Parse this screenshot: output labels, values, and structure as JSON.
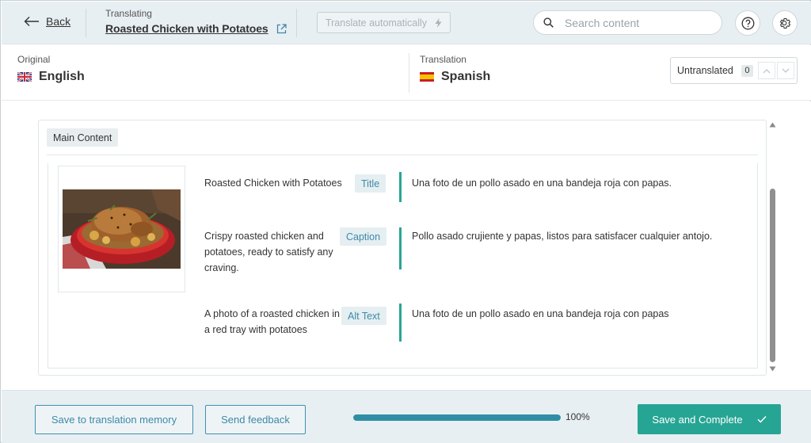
{
  "header": {
    "back_label": "Back",
    "translating_label": "Translating",
    "document_title": "Roasted Chicken with Potatoes",
    "translate_auto_label": "Translate automatically",
    "search_placeholder": "Search content"
  },
  "languages": {
    "original_label": "Original",
    "original_language": "English",
    "translation_label": "Translation",
    "translation_language": "Spanish",
    "filter_label": "Untranslated",
    "filter_count": "0"
  },
  "section": {
    "label": "Main Content",
    "rows": [
      {
        "source": "Roasted Chicken with Potatoes",
        "field": "Title",
        "target": "Una foto de un pollo asado en una bandeja roja con papas."
      },
      {
        "source": "Crispy roasted chicken and potatoes, ready to satisfy any craving.",
        "field": "Caption",
        "target": "Pollo asado crujiente y papas, listos para satisfacer cualquier antojo."
      },
      {
        "source": "A photo of a roasted chicken in a red tray with potatoes",
        "field": "Alt Text",
        "target": "Una foto de un pollo asado en una bandeja roja con papas"
      }
    ]
  },
  "footer": {
    "memory_label": "Save to translation memory",
    "feedback_label": "Send feedback",
    "progress_percent": 100,
    "progress_label": "100%",
    "complete_label": "Save and Complete"
  },
  "colors": {
    "accent_teal": "#27a594",
    "link_blue": "#3e89a8",
    "header_bg": "#e8eff2"
  }
}
